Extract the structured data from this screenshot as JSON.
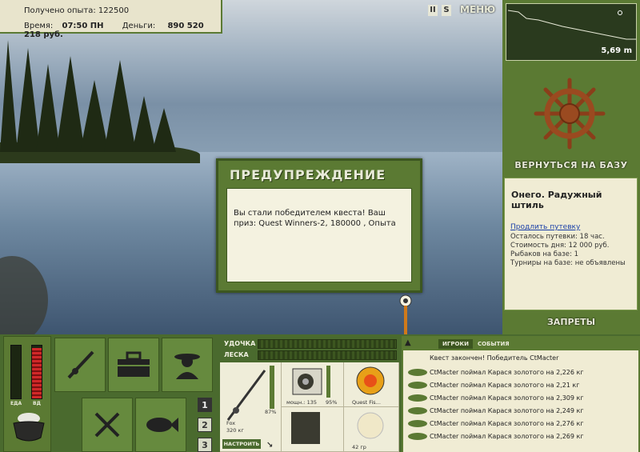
{
  "top_info": {
    "experience_label": "Получено опыта:",
    "experience_value": "122500",
    "time_label": "Время:",
    "time_value": "07:50 ПН",
    "money_label": "Деньги:",
    "money_value": "890 520 218 руб."
  },
  "toolbar": {
    "pause_label": "II",
    "sound_label": "S",
    "menu_label": "МЕНЮ"
  },
  "depth": {
    "value": "5,69 m"
  },
  "right_panel": {
    "return_label": "ВЕРНУТЬСЯ НА БАЗУ",
    "location_title": "Онего. Радужный штиль",
    "extend_link": "Продлить путевку",
    "lines": [
      "Осталось путевки: 18 час.",
      "Стоимость дня: 12 000 руб.",
      "Рыбаков на базе: 1",
      "Турниры на базе: не объявлены"
    ],
    "bans_label": "ЗАПРЕТЫ"
  },
  "dialog": {
    "title": "ПРЕДУПРЕЖДЕНИЕ",
    "message": "Вы стали победителем квеста! Ваш приз: Quest Winners-2, 180000 , Опыта"
  },
  "status_meters": {
    "food_label": "ЕДА",
    "vd_label": "ВД",
    "food_level": 0.0,
    "vd_level": 0.95
  },
  "pages": [
    "1",
    "2",
    "3"
  ],
  "tackle": {
    "rod_label": "УДОЧКА",
    "line_label": "ЛЕСКА",
    "rod_name": "Fox",
    "rod_weight": "320 кг",
    "rod_percent": "87%",
    "reel_power": "мощн.: 135",
    "reel_percent": "95%",
    "line_item": "Quest Fis...",
    "bait_weight": "42 гр",
    "setup_button": "НАСТРОИТЬ"
  },
  "chat": {
    "tabs": [
      "ИГРОКИ",
      "СОБЫТИЯ"
    ],
    "header": "Квест закончен! Победитель CtMacter",
    "messages": [
      "CtMacter поймал Карася золотого на 2,226 кг",
      "CtMacter поймал Карася золотого на 2,21 кг",
      "CtMacter поймал Карася золотого на 2,309 кг",
      "CtMacter поймал Карася золотого на 2,249 кг",
      "CtMacter поймал Карася золотого на 2,276 кг",
      "CtMacter поймал Карася золотого на 2,269 кг"
    ]
  }
}
